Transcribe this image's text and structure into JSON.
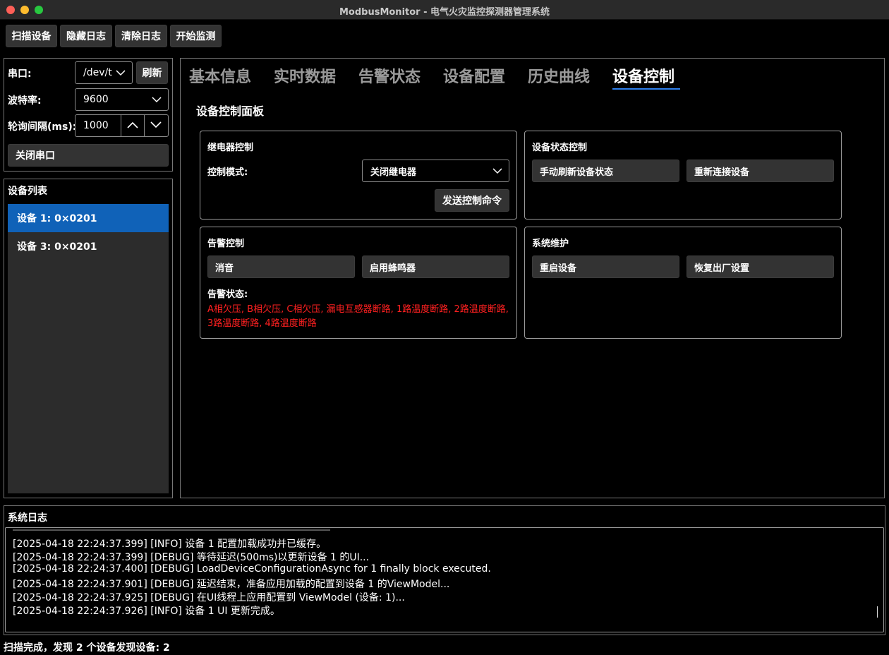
{
  "window": {
    "title": "ModbusMonitor - 电气火灾监控探测器管理系统"
  },
  "toolbar": {
    "scan": "扫描设备",
    "hide_log": "隐藏日志",
    "clear_log": "清除日志",
    "start_monitor": "开始监测"
  },
  "connection": {
    "port_label": "串口:",
    "port_value": "/dev/t",
    "refresh": "刷新",
    "baud_label": "波特率:",
    "baud_value": "9600",
    "interval_label": "轮询间隔(ms):",
    "interval_value": "1000",
    "close_port": "关闭串口"
  },
  "device_list": {
    "title": "设备列表",
    "items": [
      {
        "label": "设备 1:  0×0201"
      },
      {
        "label": "设备 3:  0×0201"
      }
    ]
  },
  "tabs": [
    "基本信息",
    "实时数据",
    "告警状态",
    "设备配置",
    "历史曲线",
    "设备控制"
  ],
  "control": {
    "title": "设备控制面板",
    "relay": {
      "title": "继电器控制",
      "mode_label": "控制模式:",
      "mode_value": "关闭继电器",
      "send": "发送控制命令"
    },
    "status": {
      "title": "设备状态控制",
      "refresh": "手动刷新设备状态",
      "reconnect": "重新连接设备"
    },
    "alarm": {
      "title": "告警控制",
      "mute": "消音",
      "buzzer": "启用蜂鸣器",
      "state_label": "告警状态:",
      "state_text": "A相欠压, B相欠压, C相欠压, 漏电互感器断路, 1路温度断路, 2路温度断路, 3路温度断路, 4路温度断路"
    },
    "maintenance": {
      "title": "系统维护",
      "restart": "重启设备",
      "factory_reset": "恢复出厂设置"
    }
  },
  "log": {
    "title": "系统日志",
    "lines": [
      "[2025-04-18 22:24:37.399] [INFO] 设备 1 配置加载成功并已缓存。",
      "[2025-04-18 22:24:37.399] [DEBUG] 等待延迟(500ms)以更新设备 1 的UI...",
      "[2025-04-18 22:24:37.400] [DEBUG] LoadDeviceConfigurationAsync for 1 finally block executed.",
      "[2025-04-18 22:24:37.901] [DEBUG] 延迟结束，准备应用加载的配置到设备 1 的ViewModel...",
      "[2025-04-18 22:24:37.925] [DEBUG] 在UI线程上应用配置到 ViewModel (设备: 1)...",
      "[2025-04-18 22:24:37.926] [INFO] 设备 1 UI 更新完成。"
    ]
  },
  "statusbar": {
    "text": "扫描完成，发现 2 个设备发现设备: 2"
  }
}
